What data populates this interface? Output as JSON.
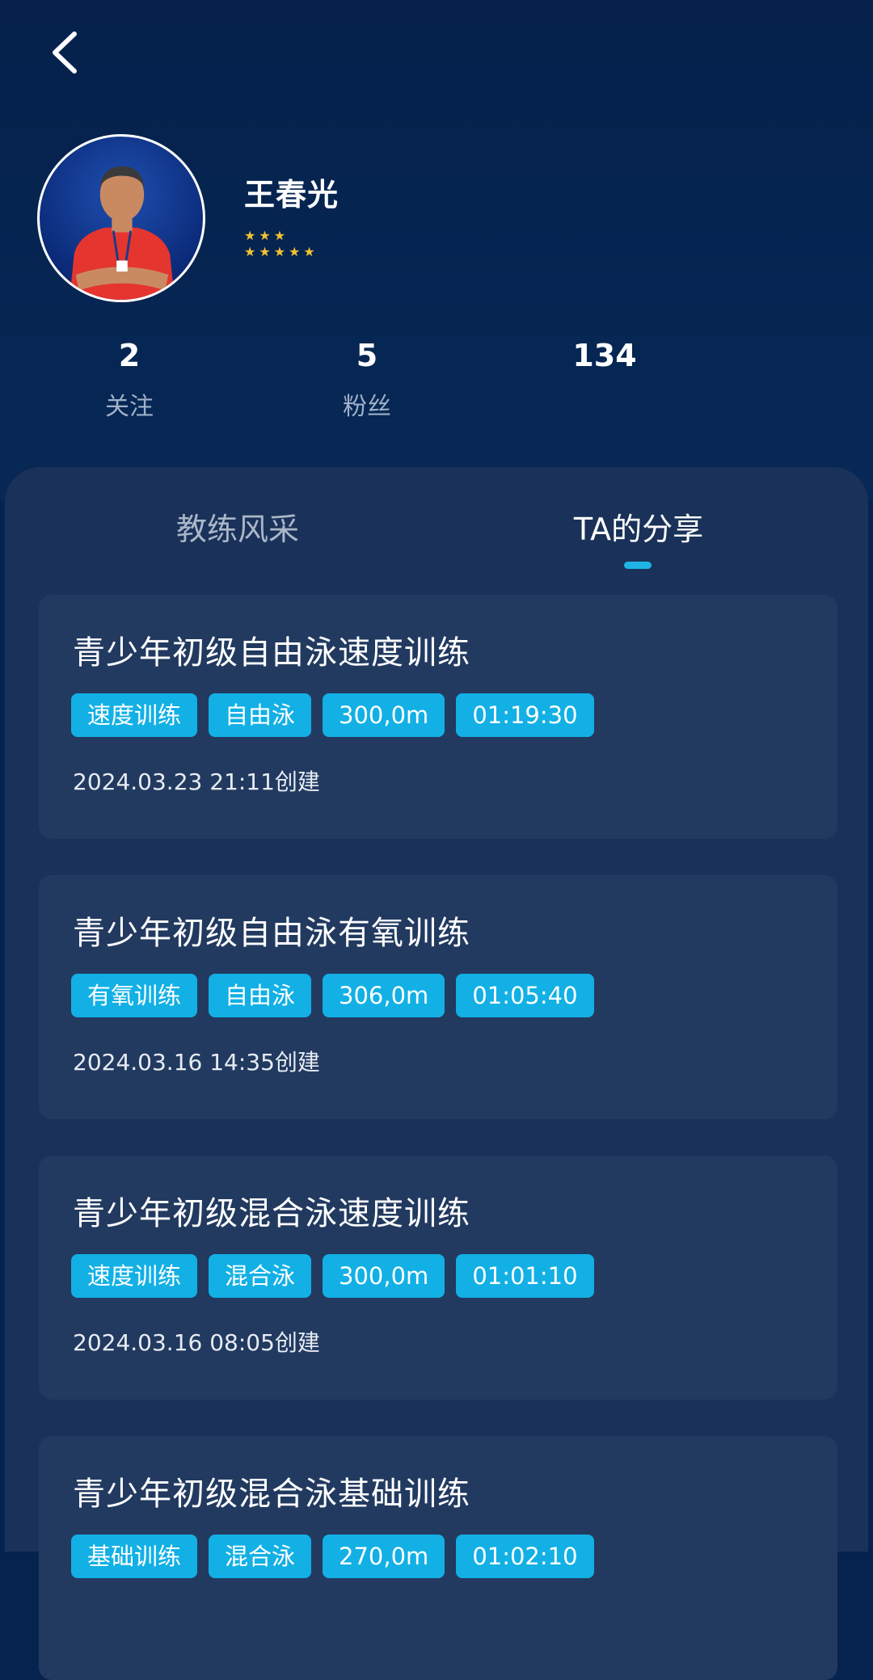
{
  "profile": {
    "name": "王春光",
    "stars_row1": "★★★",
    "stars_row2": "★★★★★"
  },
  "stats": [
    {
      "value": "2",
      "label": "关注"
    },
    {
      "value": "5",
      "label": "粉丝"
    },
    {
      "value": "134",
      "label": ""
    }
  ],
  "tabs": [
    {
      "label": "教练风采",
      "active": false
    },
    {
      "label": "TA的分享",
      "active": true
    }
  ],
  "cards": [
    {
      "title": "青少年初级自由泳速度训练",
      "tags": [
        "速度训练",
        "自由泳",
        "300,0m",
        "01:19:30"
      ],
      "date": "2024.03.23 21:11创建"
    },
    {
      "title": "青少年初级自由泳有氧训练",
      "tags": [
        "有氧训练",
        "自由泳",
        "306,0m",
        "01:05:40"
      ],
      "date": "2024.03.16 14:35创建"
    },
    {
      "title": "青少年初级混合泳速度训练",
      "tags": [
        "速度训练",
        "混合泳",
        "300,0m",
        "01:01:10"
      ],
      "date": "2024.03.16 08:05创建"
    },
    {
      "title": "青少年初级混合泳基础训练",
      "tags": [
        "基础训练",
        "混合泳",
        "270,0m",
        "01:02:10"
      ],
      "date": ""
    }
  ],
  "colors": {
    "background": "#062350",
    "panel": "#1a3259",
    "card": "#223a60",
    "accent": "#12b0e5",
    "star": "#f2c233"
  },
  "icons": {
    "back": "chevron-left-icon"
  }
}
